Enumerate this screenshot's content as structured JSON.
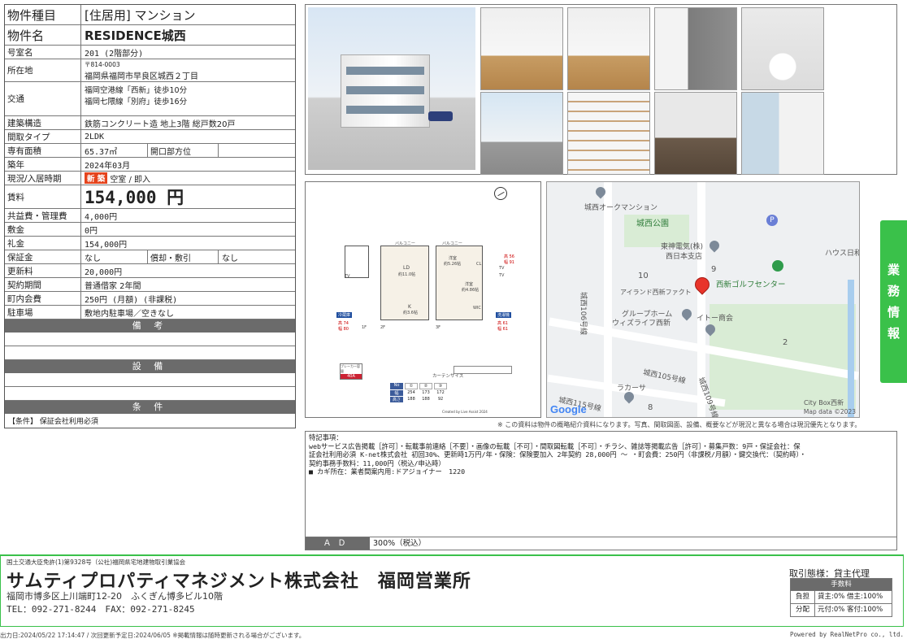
{
  "property": {
    "type_label": "物件種目",
    "type_value": "[住居用] マンション",
    "name_label": "物件名",
    "name_value": "RESIDENCE城西",
    "room_label": "号室名",
    "room_value": "201 (2階部分)",
    "location_label": "所在地",
    "postal": "〒814-0003",
    "address": "福岡県福岡市早良区城西２丁目",
    "transport_label": "交通",
    "transport_1": "福岡空港線「西新」徒歩10分",
    "transport_2": "福岡七隈線「別府」徒歩16分",
    "structure_label": "建築構造",
    "structure_value": "鉄筋コンクリート造 地上3階 総戸数20戸",
    "layout_label": "間取タイプ",
    "layout_value": "2LDK",
    "area_label": "専有面積",
    "area_value": "65.37㎡",
    "opening_label": "開口部方位",
    "opening_value": "",
    "built_label": "築年",
    "built_value": "2024年03月",
    "status_label": "現況/入居時期",
    "status_badge": "新 築",
    "status_value": "空室 / 即入",
    "rent_label": "賃料",
    "rent_value": "154,000 円",
    "mgmt_label": "共益費・管理費",
    "mgmt_value": "4,000円",
    "deposit_label": "敷金",
    "deposit_value": "0円",
    "key_money_label": "礼金",
    "key_money_value": "154,000円",
    "guarantee_label": "保証金",
    "guarantee_value": "なし",
    "amort_label": "償却・敷引",
    "amort_value": "なし",
    "renewal_label": "更新料",
    "renewal_value": "20,000円",
    "contract_label": "契約期間",
    "contract_value": "普通借家 2年間",
    "town_fee_label": "町内会費",
    "town_fee_value": "250円 (月額) (非課税)",
    "parking_label": "駐車場",
    "parking_value": "敷地内駐車場／空きなし",
    "remarks_head": "備 考",
    "remarks_body": "",
    "facilities_head": "設 備",
    "facilities_body": "",
    "conditions_head": "条 件",
    "conditions_body": "【条件】 保証会社利用必須"
  },
  "floorplan": {
    "balcony_1": "バルコニー",
    "balcony_2": "バルコニー",
    "ld": "LD",
    "ld_size": "約11.0帖",
    "k": "K",
    "k_size": "約3.6帖",
    "western_1": "洋室",
    "western_1_size": "約5.26帖",
    "western_2": "洋室",
    "western_2_size": "約4.86帖",
    "cl": "CL",
    "wic": "WIC",
    "tv_1": "TV",
    "tv_2": "TV",
    "tv_3": "TV",
    "floor_1f": "1F",
    "floor_2f": "2F",
    "floor_3f": "3F",
    "window_left": "冷蔵庫",
    "window_right": "洗濯機",
    "left_h": "高 74",
    "left_w": "幅 80",
    "right_h1": "高 56",
    "right_w1": "幅 91",
    "right_h2": "高 61",
    "right_w2": "幅 61",
    "breaker": "ブレーカー容量",
    "breaker_val": "40A",
    "curtain_title": "カーテンサイズ",
    "curtain_header": [
      "No",
      "①",
      "②",
      "③"
    ],
    "curtain_w": [
      "幅",
      "254",
      "173",
      "172"
    ],
    "curtain_h": [
      "高さ",
      "188",
      "188",
      "92"
    ],
    "credit": "Created by Live Assist 2024"
  },
  "map": {
    "labels": [
      "城西オークマンション",
      "城西公園",
      "東神電気(株)",
      "西日本支店",
      "ハウス日和",
      "10",
      "9",
      "西新ゴルフセンター",
      "アイランド西新ファクト",
      "グループホーム",
      "ウィズライフ西新",
      "イトー商会",
      "2",
      "城西106号線",
      "城西105号線",
      "ラカーサ",
      "城西109号線",
      "城西115号線",
      "8",
      "City Box西新"
    ],
    "logo": "Google",
    "data_credit": "Map data ©2023"
  },
  "side_tab": [
    "業",
    "務",
    "情",
    "報"
  ],
  "disclaimer": "※ この資料は物件の概略紹介資料になります。写真、間取図面、設備、概要などが現況と異なる場合は現況優先となります。",
  "notes": {
    "title": "特記事項：",
    "lines": [
      "webサービス広告掲載［許可］・転載事前連絡［不要］・画像の転載［不可］・間取図転載［不可］・チラシ、雑誌等掲載広告［許可］・募集戸数：9戸・保証会社：保",
      "証会社利用必須 K-net株式会社 初回30%、更新時1万円/年・保険：保険要加入 2年契約 28,000円 ～ ・町会費：250円（非課税/月額）・鍵交換代：（契約時）・",
      "契約事務手数料：11,000円（税込/申込時）",
      "■ カギ所在：業者間案内用:ドアジョイナー　1220"
    ],
    "ad_label": "ＡＤ",
    "ad_value": "300%（税込）"
  },
  "footer": {
    "license": "国土交通大臣免許(1)第9328号（公社)福岡県宅地建物取引業協会",
    "company": "サムティプロパティマネジメント株式会社　福岡営業所",
    "address": "福岡市博多区上川端町12-20　ふくぎん博多ビル10階",
    "tel": "TEL：092-271-8244　FAX：092-271-8245",
    "deal": "取引態様：貸主代理",
    "fee_head": "手数料",
    "fee_rows": [
      [
        "負担",
        "貸主:0%  借主:100%"
      ],
      [
        "分配",
        "元付:0%  客付:100%"
      ]
    ],
    "output": "出力日:2024/05/22 17:14:47 / 次回更新予定日:2024/06/05 ※掲載情報は随時更新される場合がございます。",
    "powered": "Powered by RealNetPro co., ltd."
  }
}
